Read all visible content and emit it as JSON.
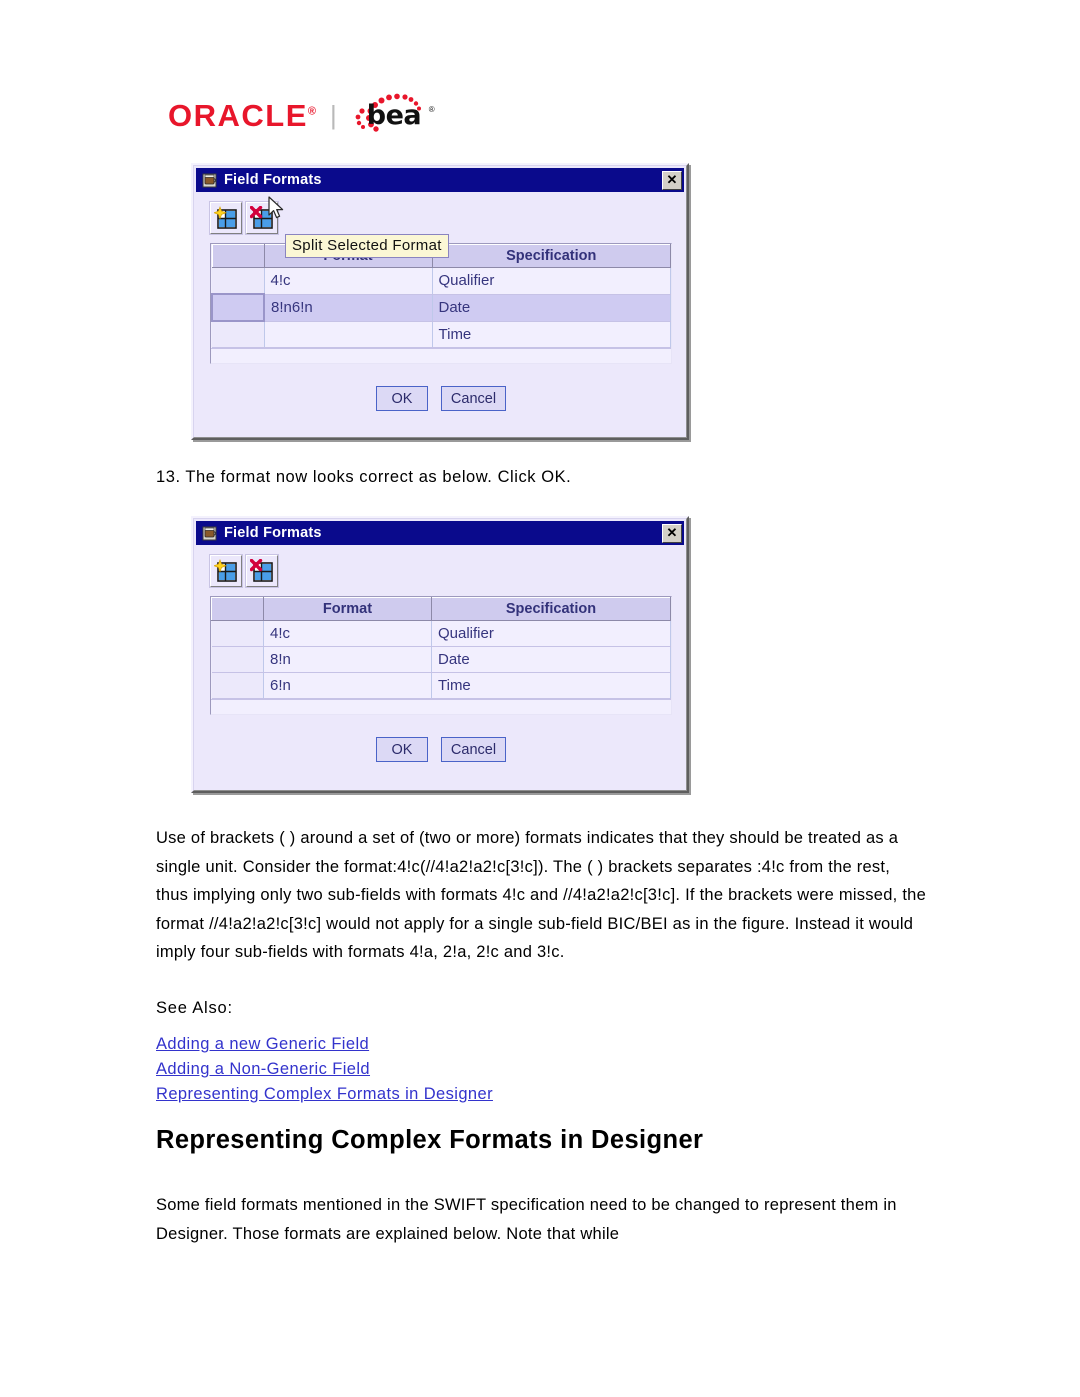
{
  "logo": {
    "oracle": "ORACLE",
    "oracle_reg": "®",
    "separator": "|",
    "bea": "bea",
    "bea_reg": "®",
    "brand_red": "#e8162b",
    "brand_black": "#111111"
  },
  "dialog1": {
    "title": "Field Formats",
    "title_icon": "java-coffee-cup-icon",
    "close_label": "✕",
    "toolbar": {
      "merge_button_icon": "grid-add-star-icon",
      "split_button_icon": "grid-delete-cross-icon"
    },
    "tooltip": "Split Selected Format",
    "columns": [
      "",
      "Format",
      "Specification"
    ],
    "rows": [
      {
        "format": "4!c",
        "specification": "Qualifier",
        "selected": false
      },
      {
        "format": "8!n6!n",
        "specification": "Date",
        "selected": true
      },
      {
        "format": "",
        "specification": "Time",
        "selected": false
      }
    ],
    "buttons": {
      "ok": "OK",
      "cancel": "Cancel"
    }
  },
  "dialog2": {
    "title": "Field Formats",
    "title_icon": "java-coffee-cup-icon",
    "close_label": "✕",
    "toolbar": {
      "merge_button_icon": "grid-add-star-icon",
      "split_button_icon": "grid-delete-cross-icon"
    },
    "columns": [
      "",
      "Format",
      "Specification"
    ],
    "rows": [
      {
        "format": "4!c",
        "specification": "Qualifier",
        "selected": false
      },
      {
        "format": "8!n",
        "specification": "Date",
        "selected": false
      },
      {
        "format": "6!n",
        "specification": "Time",
        "selected": false
      }
    ],
    "buttons": {
      "ok": "OK",
      "cancel": "Cancel"
    }
  },
  "content": {
    "step_13": "13. The format now looks correct as below. Click OK.",
    "paragraph_brackets": "Use of brackets ( ) around a set of (two or more) formats indicates that they should be treated as a single unit. Consider the format:4!c(//4!a2!a2!c[3!c]). The ( ) brackets separates :4!c from the rest, thus implying only two sub-fields with formats 4!c and //4!a2!a2!c[3!c]. If the brackets were missed, the format //4!a2!a2!c[3!c] would not apply for a single sub-field BIC/BEI as in the figure. Instead it would imply four sub-fields with formats 4!a, 2!a, 2!c and 3!c.",
    "see_also_label": "See Also:",
    "see_also_links": [
      "Adding a new Generic Field",
      "Adding a Non-Generic Field",
      "Representing Complex Formats in Designer"
    ],
    "heading": "Representing Complex Formats in Designer",
    "paragraph_closing": "Some field formats mentioned in the SWIFT specification need to be changed to represent them in Designer. Those formats are explained below. Note that while",
    "link_color": "#3333cc"
  }
}
